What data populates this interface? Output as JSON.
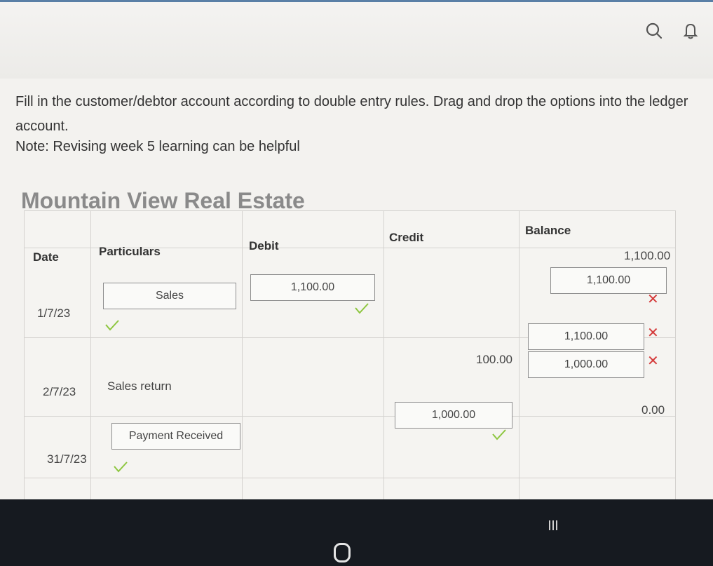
{
  "instructions": {
    "line1": "Fill in the customer/debtor account according to double entry rules.  Drag and drop the options into the ledger",
    "line2": "account.",
    "note": "Note: Revising week 5 learning can be helpful"
  },
  "ledger": {
    "title": "Mountain View Real Estate",
    "headers": {
      "date": "Date",
      "particulars": "Particulars",
      "debit": "Debit",
      "credit": "Credit",
      "balance": "Balance"
    },
    "opening_balance": "1,100.00",
    "rows": [
      {
        "date": "1/7/23",
        "particulars": "Sales",
        "debit": "1,100.00",
        "balance": "1,100.00",
        "particulars_correct": true,
        "debit_correct": true,
        "balance_correct": false
      },
      {
        "date": "2/7/23",
        "particulars": "Sales return",
        "credit": "100.00",
        "balance_options": [
          "1,100.00",
          "1,000.00"
        ],
        "balance_correct": false
      },
      {
        "date": "31/7/23",
        "particulars": "Payment Received",
        "credit": "1,000.00",
        "balance": "0.00",
        "particulars_correct": true,
        "credit_correct": true
      }
    ]
  },
  "icons": {
    "search": "search-icon",
    "notifications": "bell-icon",
    "correct": "check-icon",
    "incorrect": "cross-icon"
  },
  "colors": {
    "correct": "#8dc63f",
    "incorrect": "#d43a3a",
    "title": "#8a8a8a"
  },
  "marks": {
    "incorrect": "✕"
  }
}
